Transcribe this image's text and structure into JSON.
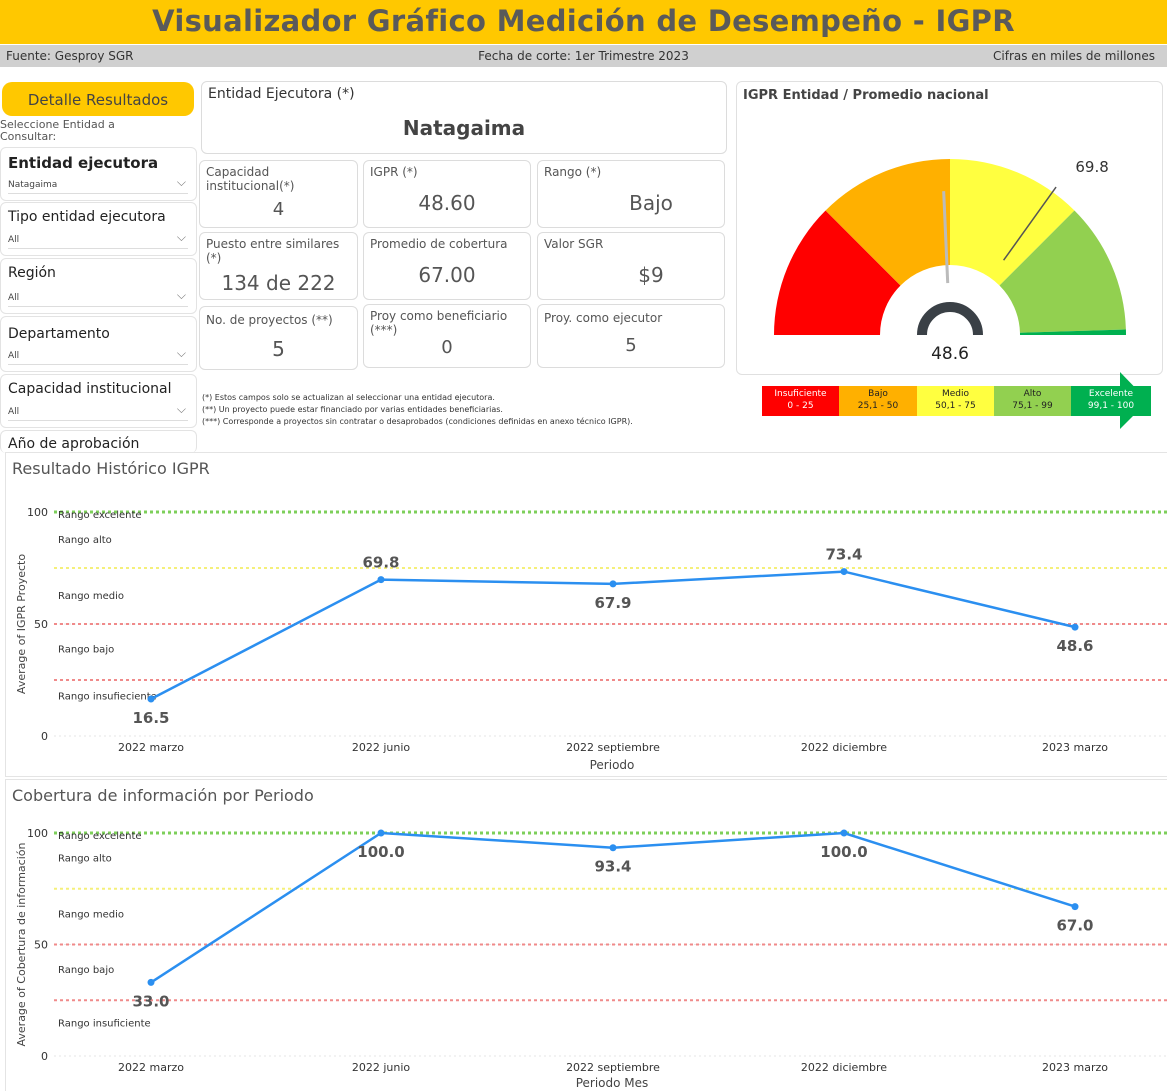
{
  "header": {
    "title": "Visualizador Gráfico Medición de Desempeño - IGPR"
  },
  "infobar": {
    "source": "Fuente: Gesproy SGR",
    "cutoff": "Fecha de corte: 1er Trimestre 2023",
    "units": "Cifras en miles de millones"
  },
  "sidebar": {
    "button": "Detalle Resultados",
    "hint": "Seleccione Entidad a Consultar:",
    "filters": [
      {
        "label": "Entidad ejecutora",
        "value": "Natagaima"
      },
      {
        "label": "Tipo entidad ejecutora",
        "value": "All"
      },
      {
        "label": "Región",
        "value": "All"
      },
      {
        "label": "Departamento",
        "value": "All"
      },
      {
        "label": "Capacidad institucional",
        "value": "All"
      },
      {
        "label": "Año de aprobación",
        "value": ""
      }
    ]
  },
  "entity": {
    "label": "Entidad Ejecutora (*)",
    "name": "Natagaima"
  },
  "cards": {
    "capacidad": {
      "label": "Capacidad institucional(*)",
      "value": "4"
    },
    "igpr": {
      "label": "IGPR (*)",
      "value": "48.60"
    },
    "rango": {
      "label": "Rango (*)",
      "value": "Bajo"
    },
    "puesto": {
      "label": "Puesto entre similares (*)",
      "value": "134 de 222"
    },
    "cobertura": {
      "label": "Promedio de cobertura",
      "value": "67.00"
    },
    "valor": {
      "label": "Valor SGR",
      "value": "$9"
    },
    "proyectos": {
      "label": "No. de proyectos (**)",
      "value": "5"
    },
    "beneficiario": {
      "label": "Proy como beneficiario (***)",
      "value": "0"
    },
    "ejecutor": {
      "label": "Proy. como ejecutor",
      "value": "5"
    }
  },
  "notes": [
    "(*) Estos campos solo se actualizan al seleccionar una entidad ejecutora.",
    "(**) Un proyecto puede estar financiado por varias entidades beneficiarias.",
    "(***) Corresponde a proyectos sin contratar o desaprobados (condiciones definidas en anexo técnico IGPR)."
  ],
  "gauge": {
    "title": "IGPR Entidad / Promedio nacional",
    "value": 48.6,
    "value_label": "48.6",
    "national": 69.8,
    "national_label": "69.8",
    "max": 100,
    "bands": [
      {
        "from": 0,
        "to": 25,
        "color": "#ff0000"
      },
      {
        "from": 25,
        "to": 50,
        "color": "#ffb000"
      },
      {
        "from": 50,
        "to": 75,
        "color": "#ffff40"
      },
      {
        "from": 75,
        "to": 99,
        "color": "#92d050"
      },
      {
        "from": 99,
        "to": 100,
        "color": "#00b050"
      }
    ]
  },
  "range_legend": [
    {
      "name": "Insuficiente",
      "range": "0 - 25",
      "bg": "#ff0000",
      "fg": "#ffffff"
    },
    {
      "name": "Bajo",
      "range": "25,1 - 50",
      "bg": "#ffb000",
      "fg": "#222222"
    },
    {
      "name": "Medio",
      "range": "50,1 - 75",
      "bg": "#ffff40",
      "fg": "#222222"
    },
    {
      "name": "Alto",
      "range": "75,1 - 99",
      "bg": "#92d050",
      "fg": "#222222"
    },
    {
      "name": "Excelente",
      "range": "99,1 - 100",
      "bg": "#00b050",
      "fg": "#ffffff"
    }
  ],
  "chart_data": [
    {
      "type": "line",
      "title": "Resultado Histórico IGPR",
      "xlabel": "Periodo",
      "ylabel": "Average of IGPR Proyecto",
      "categories": [
        "2022 marzo",
        "2022 junio",
        "2022 septiembre",
        "2022 diciembre",
        "2023 marzo"
      ],
      "values": [
        16.5,
        69.8,
        67.9,
        73.4,
        48.6
      ],
      "labels": [
        "16.5",
        "69.8",
        "67.9",
        "73.4",
        "48.6"
      ],
      "ylim": [
        0,
        100
      ],
      "yticks": [
        "0",
        "50",
        "100"
      ],
      "line_color": "#2b8ff0",
      "ref_lines": [
        {
          "y": 100,
          "label": "Rango excelente",
          "color": "#7dcf5a"
        },
        {
          "y": 75,
          "label": "Rango alto",
          "color": "#f5f07a"
        },
        {
          "y": 50,
          "label": "Rango medio",
          "color": "#f08a8a"
        },
        {
          "y": 25,
          "label": "Rango bajo",
          "color": "#f08a8a"
        }
      ],
      "band_labels": [
        {
          "y": 99,
          "text": "Rango excelente"
        },
        {
          "y": 88,
          "text": "Rango alto"
        },
        {
          "y": 63,
          "text": "Rango medio"
        },
        {
          "y": 39,
          "text": "Rango bajo"
        },
        {
          "y": 18,
          "text": "Rango insufieciente"
        }
      ]
    },
    {
      "type": "line",
      "title": "Cobertura de información por Periodo",
      "xlabel": "Periodo Mes",
      "ylabel": "Average of Cobertura de información",
      "categories": [
        "2022 marzo",
        "2022 junio",
        "2022 septiembre",
        "2022 diciembre",
        "2023 marzo"
      ],
      "values": [
        33.0,
        100.0,
        93.4,
        100.0,
        67.0
      ],
      "labels": [
        "33.0",
        "100.0",
        "93.4",
        "100.0",
        "67.0"
      ],
      "ylim": [
        0,
        100
      ],
      "yticks": [
        "0",
        "50",
        "100"
      ],
      "line_color": "#2b8ff0",
      "ref_lines": [
        {
          "y": 100,
          "label": "Rango excelente",
          "color": "#7dcf5a"
        },
        {
          "y": 75,
          "label": "Rango alto",
          "color": "#f5f07a"
        },
        {
          "y": 50,
          "label": "Rango medio",
          "color": "#f08a8a"
        },
        {
          "y": 25,
          "label": "Rango bajo",
          "color": "#f08a8a"
        }
      ],
      "band_labels": [
        {
          "y": 99,
          "text": "Rango excelente"
        },
        {
          "y": 89,
          "text": "Rango alto"
        },
        {
          "y": 64,
          "text": "Rango medio"
        },
        {
          "y": 39,
          "text": "Rango bajo"
        },
        {
          "y": 15,
          "text": "Rango insuficiente"
        }
      ]
    }
  ]
}
